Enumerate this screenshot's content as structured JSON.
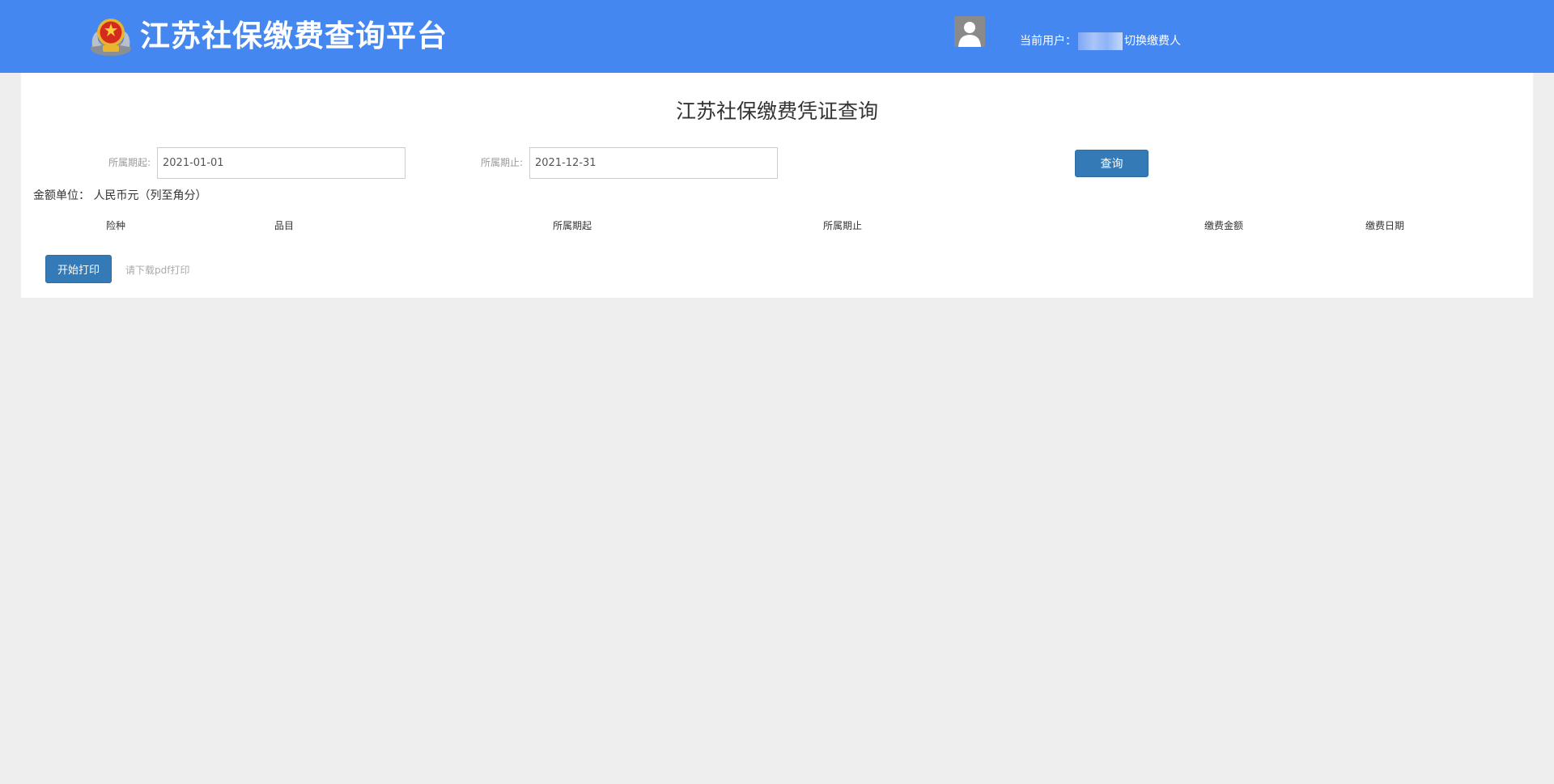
{
  "header": {
    "site_title": "江苏社保缴费查询平台",
    "user_label": "当前用户：",
    "switch_label": "切换缴费人"
  },
  "colors": {
    "header_bg": "#4587f0",
    "primary_button": "#337ab7",
    "page_bg": "#eeeeee"
  },
  "icons": {
    "logo": "tax-emblem-icon",
    "avatar": "user-avatar-icon"
  },
  "main": {
    "title": "江苏社保缴费凭证查询",
    "filters": {
      "period_start_label": "所属期起:",
      "period_start_value": "2021-01-01",
      "period_end_label": "所属期止:",
      "period_end_value": "2021-12-31",
      "query_button": "查询"
    },
    "amount_unit": "金额单位： 人民币元（列至角分）",
    "table": {
      "columns": [
        "险种",
        "品目",
        "所属期起",
        "所属期止",
        "缴费金额",
        "缴费日期"
      ],
      "rows": []
    },
    "print_button": "开始打印",
    "print_hint": "请下载pdf打印"
  }
}
